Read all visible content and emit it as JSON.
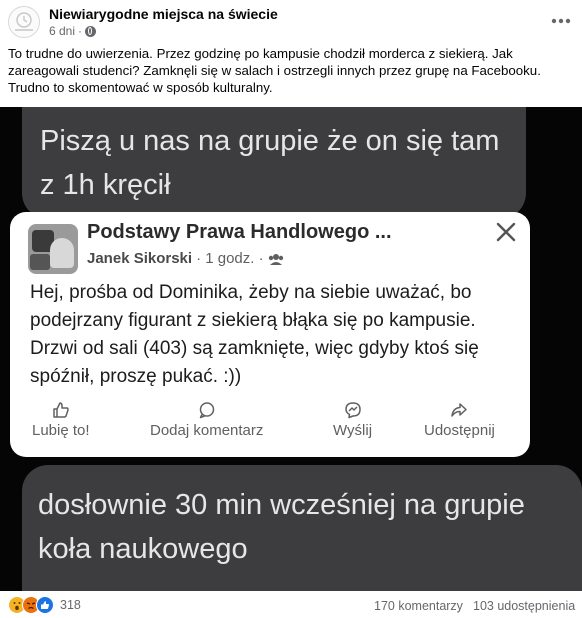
{
  "post": {
    "page_name": "Niewiarygodne miejsca na świecie",
    "time": "6 dni",
    "separator": "·",
    "caption": "To trudne do uwierzenia. Przez godzinę po kampusie chodził morderca z siekierą. Jak zareagowali studenci? Zamknęli się w salach i ostrzegli innych przez grupę na Facebooku. Trudno to skomentować w sposób kulturalny."
  },
  "image": {
    "bubble_top": "Piszą u nas na grupie że on się tam z 1h kręcił",
    "card": {
      "group_name": "Podstawy Prawa Handlowego ...",
      "author": "Janek Sikorski",
      "time": "· 1 godz. ·",
      "text": "Hej, prośba od Dominika, żeby na siebie uważać, bo podejrzany figurant z siekierą  błąka się po kampusie. Drzwi od sali (403) są zamknięte, więc gdyby ktoś się spóźnił, proszę pukać. :))",
      "actions": {
        "like": "Lubię to!",
        "comment": "Dodaj komentarz",
        "send": "Wyślij",
        "share": "Udostępnij"
      }
    },
    "bubble_bottom": "dosłownie 30 min wcześniej na grupie koła naukowego"
  },
  "footer": {
    "reaction_count": "318",
    "comments": "170 komentarzy",
    "shares": "103 udostępnienia"
  },
  "icons": [
    "globe-icon",
    "more-icon",
    "close-icon",
    "group-icon",
    "like-icon",
    "comment-icon",
    "messenger-icon",
    "share-icon",
    "reaction-wow-icon",
    "reaction-angry-icon",
    "reaction-like-icon"
  ],
  "colors": {
    "bubble": "#3d3d3f",
    "photo_bg": "#050505",
    "meta_gray": "#65676b",
    "like_blue": "#1b74e4"
  }
}
